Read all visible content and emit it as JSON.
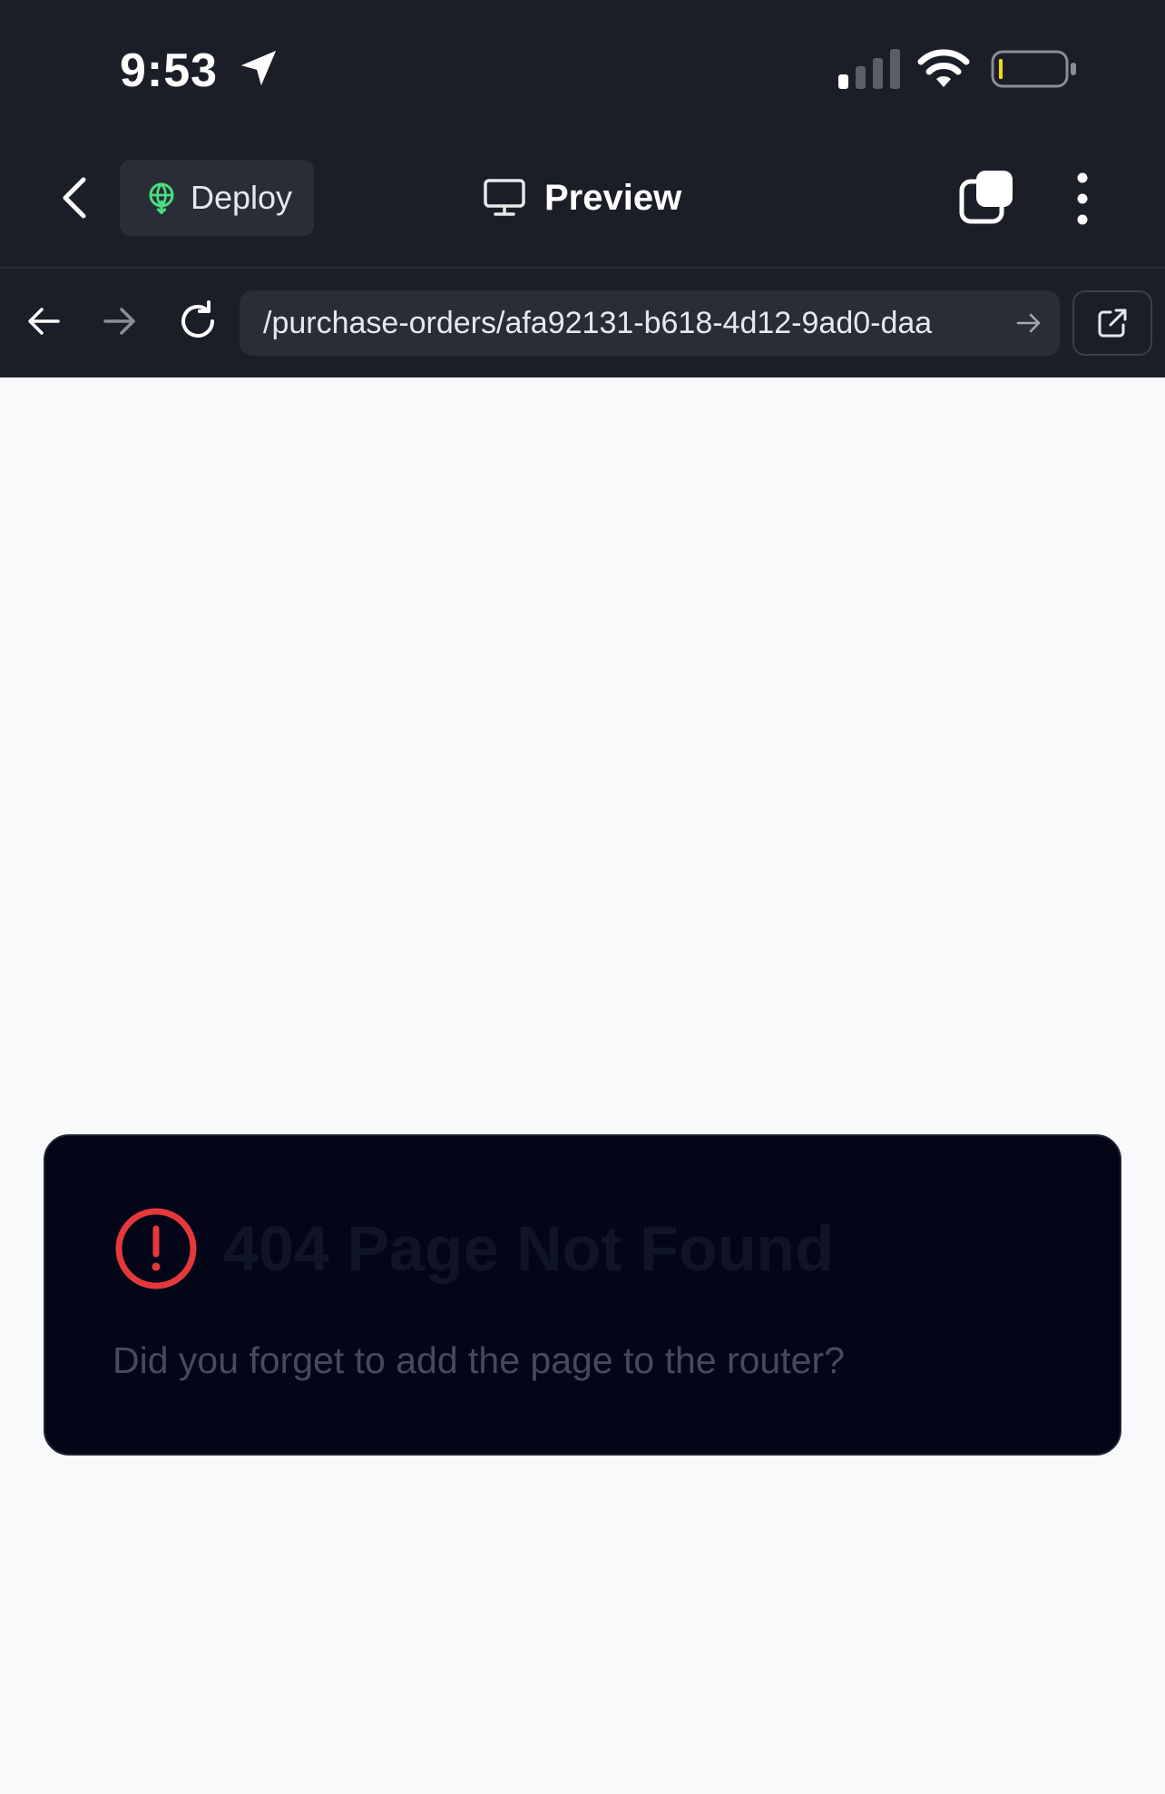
{
  "status_bar": {
    "time": "9:53",
    "battery_color": "#f5d90a"
  },
  "nav": {
    "deploy_label": "Deploy",
    "preview_label": "Preview"
  },
  "browser": {
    "url": "/purchase-orders/afa92131-b618-4d12-9ad0-daa"
  },
  "error": {
    "title": "404 Page Not Found",
    "message": "Did you forget to add the page to the router?",
    "icon_color": "#e5383b"
  },
  "colors": {
    "topbar": "#1c1e27",
    "page_bg": "#f8f9fb",
    "card_bg": "#030617",
    "deploy_icon": "#4ade80"
  }
}
